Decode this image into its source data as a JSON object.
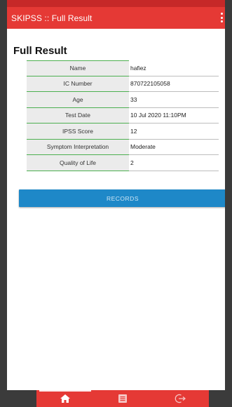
{
  "app": {
    "title": "SKIPSS :: Full Result"
  },
  "page": {
    "title": "Full Result"
  },
  "result": {
    "rows": [
      {
        "label": "Name",
        "value": "hafiez"
      },
      {
        "label": "IC Number",
        "value": "870722105058"
      },
      {
        "label": "Age",
        "value": "33"
      },
      {
        "label": "Test Date",
        "value": "10 Jul 2020 11:10PM"
      },
      {
        "label": "IPSS Score",
        "value": "12"
      },
      {
        "label": "Symptom Interpretation",
        "value": "Moderate"
      },
      {
        "label": "Quality of Life",
        "value": "2"
      }
    ]
  },
  "actions": {
    "records_label": "RECORDS"
  },
  "nav": {
    "items": [
      {
        "icon": "home-icon",
        "active": true
      },
      {
        "icon": "list-icon",
        "active": false
      },
      {
        "icon": "logout-icon",
        "active": false
      }
    ]
  },
  "colors": {
    "accent": "#e53935",
    "button": "#1e88c8",
    "divider": "#4caf50"
  }
}
